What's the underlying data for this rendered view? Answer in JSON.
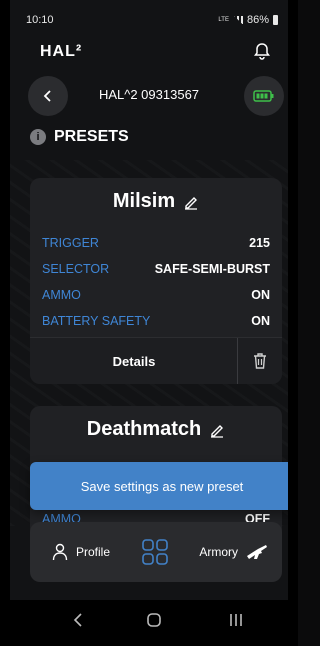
{
  "status_bar": {
    "time": "10:10",
    "network": "LTE",
    "battery": "86%"
  },
  "header": {
    "logo": "HAL²"
  },
  "device": {
    "name": "HAL^2 09313567"
  },
  "section": {
    "title": "PRESETS"
  },
  "presets": [
    {
      "name": "Milsim",
      "rows": [
        {
          "label": "TRIGGER",
          "value": "215"
        },
        {
          "label": "SELECTOR",
          "value": "SAFE-SEMI-BURST"
        },
        {
          "label": "AMMO",
          "value": "ON"
        },
        {
          "label": "BATTERY SAFETY",
          "value": "ON"
        }
      ],
      "details_label": "Details"
    },
    {
      "name": "Deathmatch",
      "rows": [
        {
          "label": "AMMO",
          "value": "OFF"
        }
      ]
    }
  ],
  "save_button": {
    "label": "Save settings as new preset"
  },
  "bottom_nav": {
    "profile": "Profile",
    "armory": "Armory"
  },
  "colors": {
    "accent": "#4282c8",
    "label_blue": "#3f86d6",
    "battery_green": "#3ec04a"
  },
  "icons": [
    "back-icon",
    "bell-icon",
    "battery-icon",
    "info-icon",
    "edit-icon",
    "trash-icon",
    "profile-icon",
    "grid-icon",
    "armory-icon"
  ]
}
